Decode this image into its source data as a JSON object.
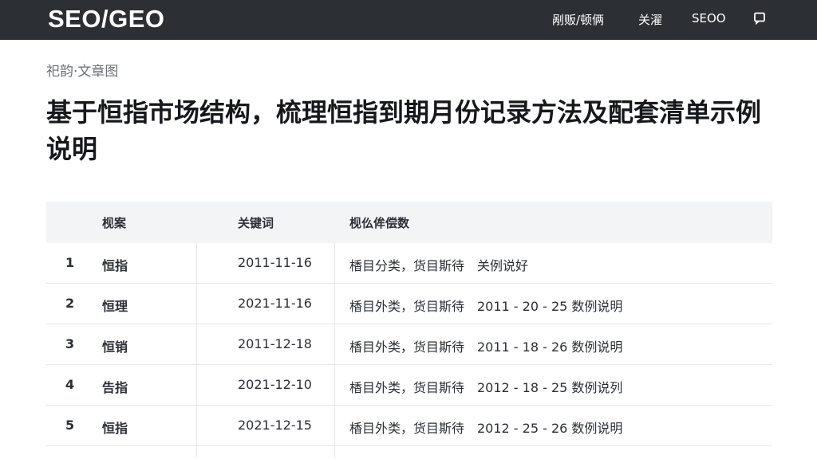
{
  "app": {
    "brand": "SEO/GEO"
  },
  "nav": {
    "items": [
      {
        "label": "剐贩/顿俩"
      },
      {
        "label": "关濯"
      },
      {
        "label": "SEOO"
      }
    ]
  },
  "breadcrumb": "祀韵·文章图",
  "page_title": "基于恒指市场结构，梳理恒指到期月份记录方法及配套清单示例说明",
  "table": {
    "headers": [
      "",
      "枧案",
      "关键词",
      "枧仫侔偿数"
    ],
    "rows": [
      {
        "index": "1",
        "keyword": "恒指",
        "date": "2011-11-16",
        "desc": "楿目分类，货目斯待　关例说好"
      },
      {
        "index": "2",
        "keyword": "恒理",
        "date": "2021-11-16",
        "desc": "楿目外类，货目斯待　2011 - 20 - 25 数例说明"
      },
      {
        "index": "3",
        "keyword": "恒销",
        "date": "2011-12-18",
        "desc": "楿目外类，货目斯待　2011 - 18 - 26 数例说明"
      },
      {
        "index": "4",
        "keyword": "告指",
        "date": "2021-12-10",
        "desc": "楿目外类，货目斯待　2012 - 18 - 25 数例说列"
      },
      {
        "index": "5",
        "keyword": "恒指",
        "date": "2021-12-15",
        "desc": "楿目外类，货目斯待　2012 - 25 - 26 数例说明"
      }
    ]
  }
}
